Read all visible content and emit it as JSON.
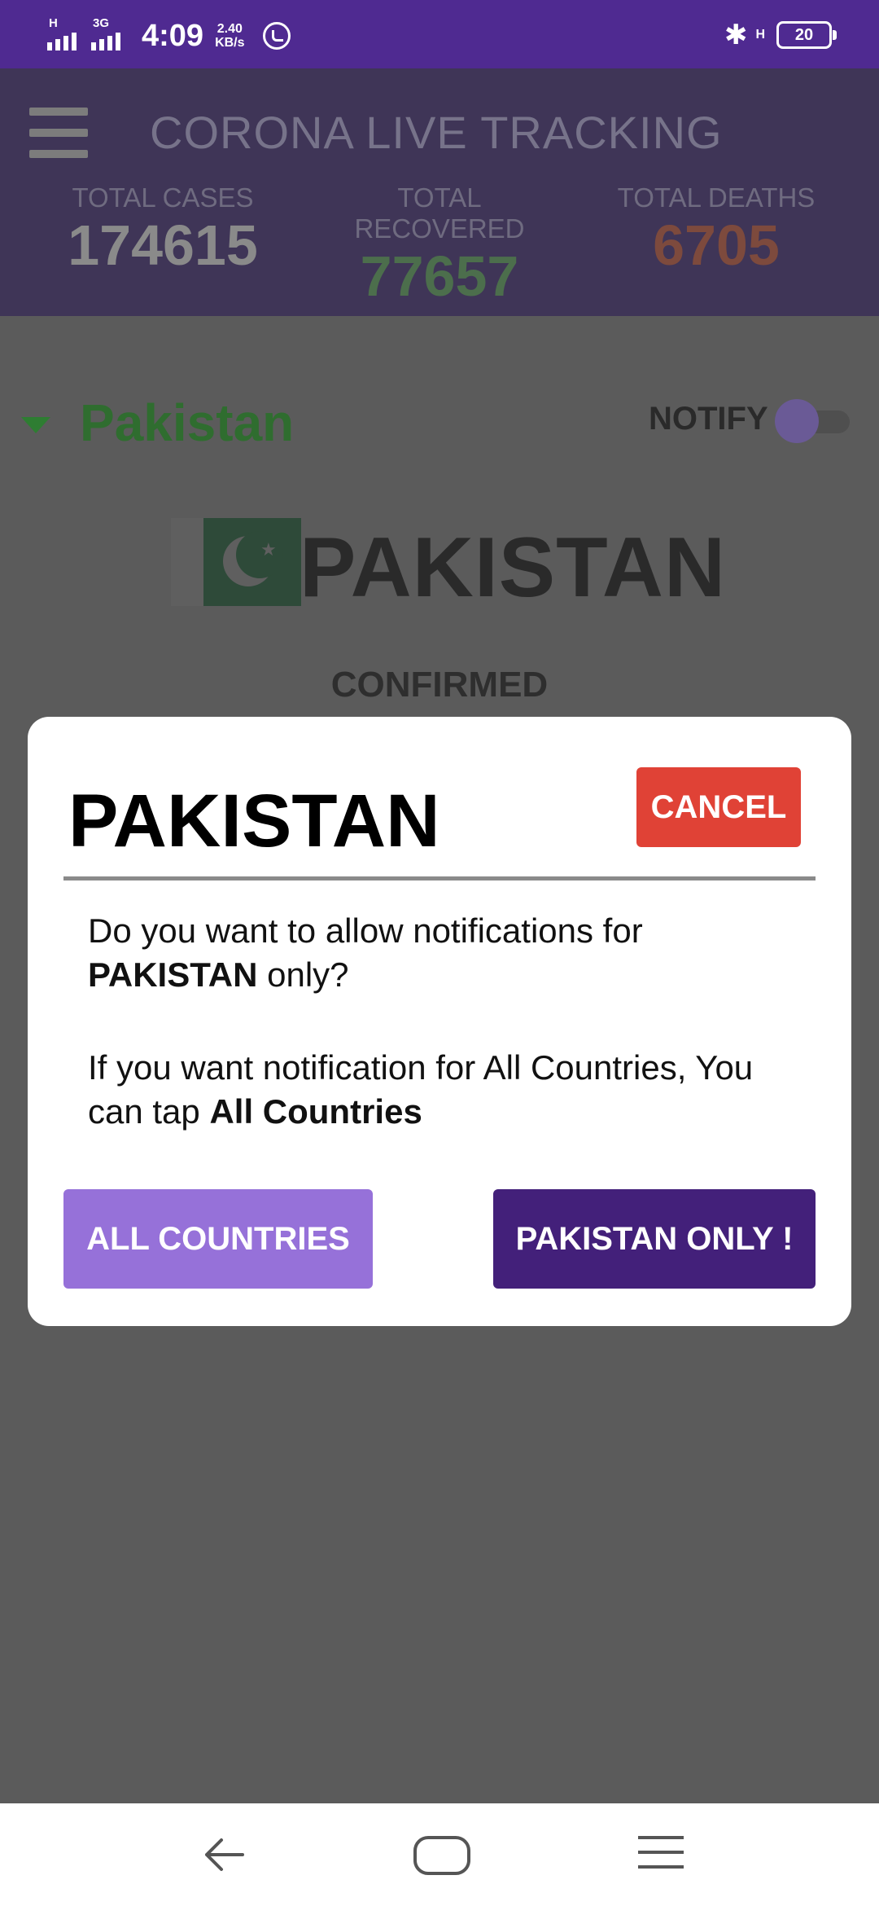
{
  "status_bar": {
    "sim1_net": "H",
    "sim2_net": "3G",
    "time": "4:09",
    "speed_value": "2.40",
    "speed_unit": "KB/s",
    "right_net": "H",
    "battery": "20"
  },
  "header": {
    "title": "CORONA LIVE TRACKING",
    "stats": [
      {
        "label": "TOTAL CASES",
        "value": "174615",
        "color": "#8a8a8a"
      },
      {
        "label": "TOTAL RECOVERED",
        "value": "77657",
        "color": "#4c6e4c"
      },
      {
        "label": "TOTAL DEATHS",
        "value": "6705",
        "color": "#7d4a3d"
      }
    ]
  },
  "content": {
    "country_selector": "Pakistan",
    "notify_label": "NOTIFY",
    "country_banner": "PAKISTAN",
    "section_label": "CONFIRMED"
  },
  "dialog": {
    "title": "PAKISTAN",
    "cancel_label": "CANCEL",
    "message1_prefix": "Do you want to allow notifications for ",
    "message1_bold": "PAKISTAN",
    "message1_suffix": " only?",
    "message2_prefix": "If you want notification for All Countries, You can tap ",
    "message2_bold": "All Countries",
    "all_countries_label": "ALL COUNTRIES",
    "only_label": "PAKISTAN ONLY !"
  },
  "colors": {
    "status_bar": "#4f2a91",
    "cancel": "#e04236",
    "all_countries": "#9671d9",
    "only": "#43207a"
  },
  "icons": {
    "menu": "hamburger-icon",
    "dropdown": "triangle-down-icon",
    "flag": "pakistan-flag-icon",
    "nav_back": "back-arrow-icon",
    "nav_home": "home-icon",
    "nav_recent": "menu-lines-icon"
  }
}
